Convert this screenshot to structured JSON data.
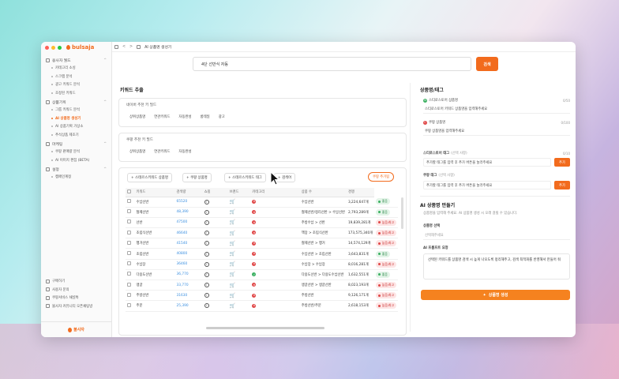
{
  "window": {
    "app_logo": "bulsaja",
    "tab_title": "AI 상품명 생성기"
  },
  "sidebar": {
    "groups": [
      {
        "label": "용사자 월드",
        "items": [
          "카테고리 소싱",
          "스크랩 분석",
          "광고 키워드 분석",
          "조정된 키워드"
        ]
      },
      {
        "label": "상품기획",
        "items": [
          "그룹 키워드 분석",
          "AI 상품명 생성기",
          "AI 상품기획 가상소",
          "추석상품 제조기"
        ]
      },
      {
        "label": "마케팅",
        "items": [
          "쿠팡 판매량 분석",
          "AI 이미지 편집 (BETA)"
        ]
      },
      {
        "label": "설정",
        "items": [
          "캠페인계정"
        ]
      }
    ],
    "active_item": "AI 상품명 생성기",
    "bottom_items": [
      "구매하기",
      "사용자 문의",
      "쿠팡서비스 채널톡",
      "불사자 커뮤니티 오픈채팅방"
    ],
    "footer_brand": "불사자"
  },
  "topbar": {
    "back": "<",
    "forward": ">",
    "tab": "AI 상품명 생성기"
  },
  "search": {
    "value": "4단 선반식 자동",
    "button": "검색"
  },
  "main": {
    "title": "키워드 추출",
    "card1": {
      "label": "네이버 추천 키 필드",
      "chips": [
        "상위상품명",
        "연관키워드",
        "자동완성",
        "롱테일",
        "광고"
      ]
    },
    "card2": {
      "label": "쿠팡 추천 키 필드",
      "chips": [
        "상위상품명",
        "연관키워드",
        "자동완성"
      ]
    },
    "toolbar": [
      "+ 스테르스키워드 상품명",
      "+ 쿠팡 상품명",
      "+ 스테르스키워드 태그",
      "+ 검색어"
    ],
    "cart_button": "쿠팡 추가됨",
    "table_headers": [
      "키워드",
      "검색량",
      "쇼핑",
      "브랜드",
      "카테고리",
      "상품 수",
      "경쟁"
    ],
    "rows": [
      {
        "keyword": "수납선반",
        "volume": "65520",
        "category": "수납선반",
        "products": "3,224,647개",
        "comp": "좋음",
        "level": "good",
        "brand": "x"
      },
      {
        "keyword": "철제선반",
        "volume": "48,390",
        "category": "철제선반/정리선반 > 수납선반",
        "products": "2,793,289개",
        "comp": "좋음",
        "level": "good",
        "brand": "x"
      },
      {
        "keyword": "선반",
        "volume": "47500",
        "category": "주방수납 > 선반",
        "products": "19,839,281개",
        "comp": "높음/최고",
        "level": "high",
        "brand": "x"
      },
      {
        "keyword": "조립식선반",
        "volume": "46640",
        "category": "책장 > 조립식선반",
        "products": "173,575,340개",
        "comp": "높음/최고",
        "level": "high",
        "brand": "x"
      },
      {
        "keyword": "행거선반",
        "volume": "41540",
        "category": "철제선반 > 행거",
        "products": "14,574,129개",
        "comp": "높음/최고",
        "level": "high",
        "brand": "x"
      },
      {
        "keyword": "조립선반",
        "volume": "40800",
        "category": "수납선반 > 조립선반",
        "products": "3,643,831개",
        "comp": "좋음",
        "level": "good",
        "brand": "x"
      },
      {
        "keyword": "수납장",
        "volume": "36460",
        "category": "수납장 > 수납장",
        "products": "8,016,281개",
        "comp": "높음/최고",
        "level": "high",
        "brand": "x"
      },
      {
        "keyword": "다용도선반",
        "volume": "36,770",
        "category": "다용도선반 > 다용도수납선반",
        "products": "1,632,551개",
        "comp": "좋음",
        "level": "good",
        "brand": "ok"
      },
      {
        "keyword": "앵글",
        "volume": "33,770",
        "category": "앵글선반 > 앵글선반",
        "products": "8,023,193개",
        "comp": "높음/최고",
        "level": "high",
        "brand": "x"
      },
      {
        "keyword": "주방선반",
        "volume": "31630",
        "category": "주방선반",
        "products": "9,126,171개",
        "comp": "높음/최고",
        "level": "high",
        "brand": "x"
      },
      {
        "keyword": "주문",
        "volume": "25,390",
        "category": "주방선반/주문",
        "products": "2,618,153개",
        "comp": "높음/최고",
        "level": "high",
        "brand": "x"
      }
    ]
  },
  "right": {
    "title": "상품명/태그",
    "s1_label": "스티로스토어 상품명",
    "s1_value": "스티로스토어 키워드 상품명을 입력해주세요",
    "s1_count": "0/50",
    "s2_label": "쿠팡 상품명",
    "s2_value": "쿠팡 상품명을 입력해주세요",
    "s2_count": "0/100",
    "s3_label": "스티로스토어 태그",
    "s3_hint": "(선택 사항)",
    "s3_value": "추가할 태그를 입력 후 추가 버튼을 눌러주세요",
    "s3_count": "0/10",
    "s3_btn": "추가",
    "s4_label": "쿠팡 태그",
    "s4_hint": "(선택 사항)",
    "s4_value": "추가할 태그를 입력 후 추가 버튼을 눌러주세요",
    "s4_btn": "추가",
    "ai_title": "AI 상품명 만들기",
    "ai_desc": "상품명을 입력해 주세요. AI 상품명 생성 시 오래 걸릴 수 있습니다.",
    "select_label": "상품명 선택",
    "select_value": "선택해주세요",
    "prompt_label": "AI 프롬프트 요청",
    "prompt_text": "선택된 키워드를 상품명 검색 시 높게 나오도록 정리해주고, 검색 최적화를 반영해서 만들어 줘",
    "gen_btn": "상품명 생성"
  }
}
